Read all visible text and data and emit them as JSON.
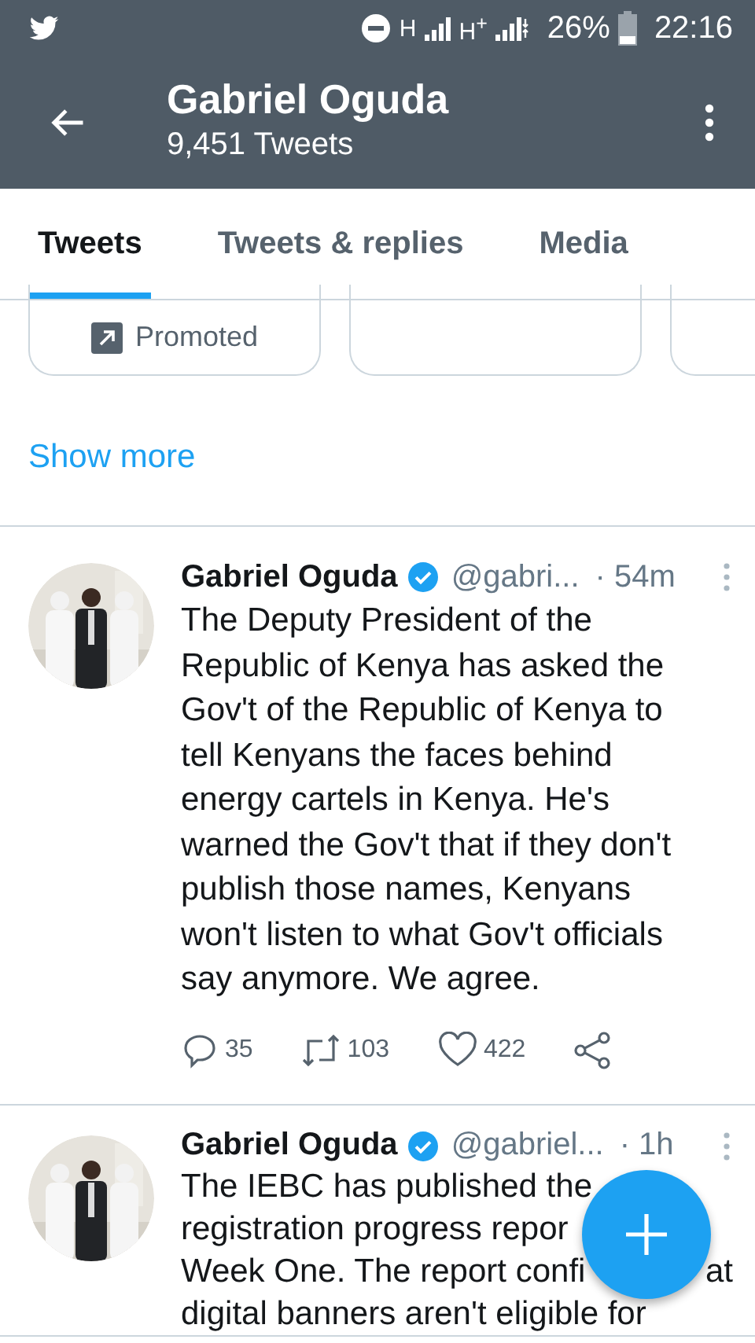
{
  "status_bar": {
    "network_1": "H",
    "network_2": "H$^{+}$",
    "battery": "26%",
    "time": "22:16"
  },
  "header": {
    "title": "Gabriel Oguda",
    "subtitle": "9,451 Tweets"
  },
  "tabs": [
    {
      "label": "Tweets",
      "selected": true
    },
    {
      "label": "Tweets & replies",
      "selected": false
    },
    {
      "label": "Media",
      "selected": false
    }
  ],
  "promoted_cards": [
    {
      "kind": "promoted",
      "label": "Promoted"
    },
    {
      "kind": "blank"
    },
    {
      "kind": "blank"
    }
  ],
  "show_more": "Show more",
  "tweets": [
    {
      "name": "Gabriel Oguda",
      "verified": true,
      "handle": "@gabri...",
      "time": "· 54m",
      "lines": [
        [
          "The Deputy President of the"
        ],
        [
          "Republic of Kenya has asked the"
        ],
        [
          "Gov't of the Republic of Kenya to"
        ],
        [
          "tell Kenyans the faces behind"
        ],
        [
          "energy cartels in Kenya. He's"
        ],
        [
          "warned the Gov't that if they don't"
        ],
        [
          "publish those names, Kenyans"
        ],
        [
          "won't listen to what Gov't officials"
        ],
        [
          "say anymore. We agree."
        ]
      ],
      "replies": "35",
      "retweets": "103",
      "likes": "422"
    },
    {
      "name": "Gabriel Oguda",
      "verified": true,
      "handle": "@gabriel...",
      "time": "· 1h",
      "lines": [
        [
          "The IEBC has published the"
        ],
        [
          "registration progress repor"
        ],
        [
          "Week One. The report confi",
          "at"
        ],
        [
          "digital banners aren't eligible for"
        ]
      ]
    }
  ]
}
